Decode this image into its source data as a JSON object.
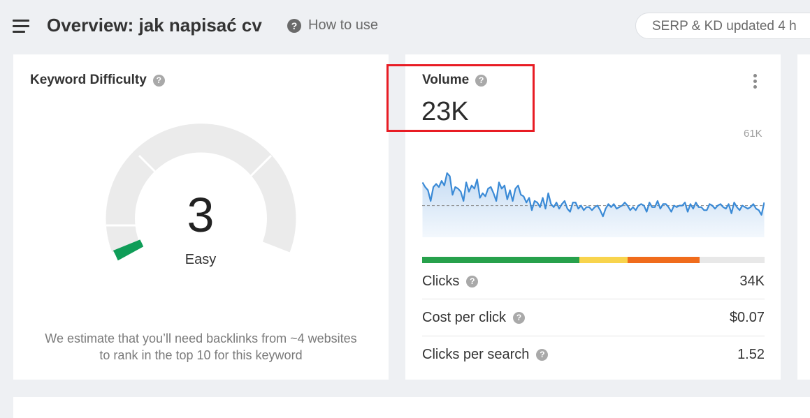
{
  "header": {
    "title": "Overview: jak napisać cv",
    "how_to_use": "How to use",
    "serp_status": "SERP & KD updated 4 h"
  },
  "keyword_difficulty": {
    "title": "Keyword Difficulty",
    "score": "3",
    "label": "Easy",
    "description_line1": "We estimate that you’ll need backlinks from ~4 websites",
    "description_line2": "to rank in the top 10 for this keyword",
    "gauge_fraction": 0.03,
    "gauge_color": "#0f9d58"
  },
  "volume": {
    "title": "Volume",
    "value": "23K",
    "max_label": "61K",
    "clicks_distribution": [
      {
        "fraction": 0.46,
        "color": "#27a14c"
      },
      {
        "fraction": 0.14,
        "color": "#f8d44d"
      },
      {
        "fraction": 0.21,
        "color": "#f06c1c"
      },
      {
        "fraction": 0.19,
        "color": "#e8e8e8"
      }
    ],
    "metrics": [
      {
        "label": "Clicks",
        "value": "34K"
      },
      {
        "label": "Cost per click",
        "value": "$0.07"
      },
      {
        "label": "Clicks per search",
        "value": "1.52"
      }
    ]
  },
  "chart_data": {
    "type": "area",
    "title": "",
    "ylim": [
      0,
      61000
    ],
    "series": [
      {
        "values": [
          38000,
          35000,
          33000,
          26000,
          35000,
          37000,
          35000,
          39000,
          36000,
          44000,
          42000,
          30000,
          35000,
          34000,
          32000,
          26000,
          38000,
          32000,
          36000,
          34000,
          40000,
          28000,
          31000,
          29000,
          34000,
          35000,
          31000,
          26000,
          38000,
          34000,
          36000,
          27000,
          33000,
          26000,
          34000,
          36000,
          30000,
          29000,
          25000,
          28000,
          20000,
          26000,
          25000,
          22000,
          28000,
          21000,
          31000,
          24000,
          22000,
          25000,
          21000,
          24000,
          26000,
          21000,
          19000,
          25000,
          25000,
          21000,
          23000,
          20000,
          22000,
          22000,
          20000,
          22000,
          23000,
          20000,
          16000,
          21000,
          24000,
          22000,
          24000,
          21000,
          22000,
          23000,
          25000,
          23000,
          20000,
          22000,
          20000,
          23000,
          24000,
          23000,
          19000,
          25000,
          22000,
          22000,
          26000,
          21000,
          24000,
          24000,
          22000,
          19000,
          23000,
          22000,
          23000,
          23000,
          25000,
          19000,
          24000,
          21000,
          25000,
          22000,
          22000,
          20000,
          20000,
          24000,
          23000,
          21000,
          23000,
          24000,
          22000,
          21000,
          24000,
          18000,
          25000,
          22000,
          20000,
          23000,
          22000,
          21000,
          22000,
          24000,
          21000,
          20000,
          17000,
          25000
        ],
        "reference_line": 23000
      }
    ]
  }
}
